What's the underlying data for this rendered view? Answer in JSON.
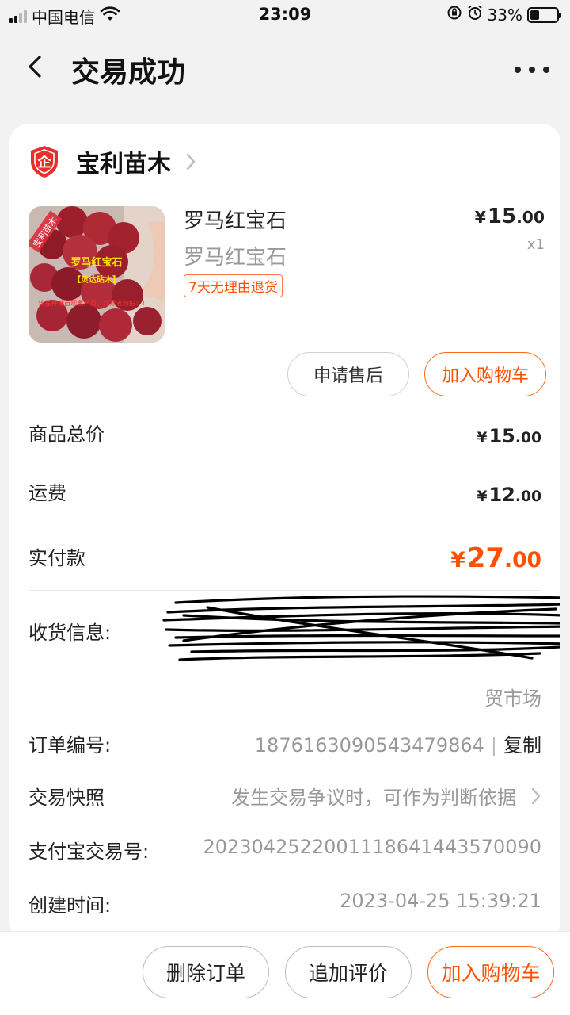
{
  "status_bar": {
    "carrier": "中国电信",
    "time": "23:09",
    "battery": "33%",
    "battery_level": 0.33
  },
  "nav": {
    "title": "交易成功"
  },
  "shop": {
    "name": "宝利苗木",
    "badge_char": "企"
  },
  "product": {
    "image_texts": {
      "corner": "宝利苗木",
      "title": "罗马红宝石",
      "subtitle": "【贝达砧木】",
      "warning": "该品种催苗现象严重，介意者勿拍！！！"
    },
    "name": "罗马红宝石",
    "sku": "罗马红宝石",
    "tag": "7天无理由退货",
    "price_symbol": "¥",
    "price_int": "15",
    "price_dec": ".00",
    "quantity": "x1"
  },
  "actions": {
    "aftersale": "申请售后",
    "add_to_cart": "加入购物车"
  },
  "summary": {
    "goods_total_label": "商品总价",
    "goods_total_int": "15",
    "goods_total_dec": ".00",
    "shipping_label": "运费",
    "shipping_int": "12",
    "shipping_dec": ".00",
    "paid_label": "实付款",
    "paid_int": "27",
    "paid_dec": ".00",
    "currency": "¥"
  },
  "info": {
    "address_label": "收货信息:",
    "address_tail": "贸市场",
    "order_no_label": "订单编号:",
    "order_no": "1876163090543479864",
    "copy": "复制",
    "snapshot_label": "交易快照",
    "snapshot_value": "发生交易争议时，可作为判断依据",
    "alipay_label": "支付宝交易号:",
    "alipay_no": "2023042522001118641443570090",
    "created_label": "创建时间:",
    "created_value": "2023-04-25 15:39:21"
  },
  "bottom_bar": {
    "delete": "删除订单",
    "review": "追加评价",
    "add_to_cart": "加入购物车"
  },
  "colors": {
    "accent": "#ff5000",
    "background": "#f2f2f2",
    "shop_badge": "#e8302a"
  }
}
